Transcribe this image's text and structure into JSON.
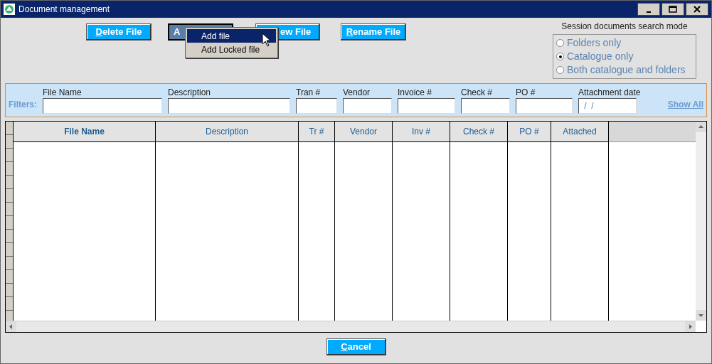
{
  "window": {
    "title": "Document management"
  },
  "toolbar": [
    {
      "kind": "button",
      "label": "Delete File",
      "underlined_first": true
    },
    {
      "kind": "pressed",
      "label": "A",
      "underlined_first": false
    },
    {
      "kind": "button",
      "label": "ew File",
      "underlined_first": false
    },
    {
      "kind": "button",
      "label": "Rename File",
      "underlined_first": true
    }
  ],
  "menu": [
    {
      "label": "Add file",
      "selected": true
    },
    {
      "label": "Add Locked file",
      "selected": false
    }
  ],
  "search_mode": {
    "title": "Session documents search mode",
    "options": [
      {
        "label": "Folders only",
        "selected": false
      },
      {
        "label": "Catalogue only",
        "selected": true
      },
      {
        "label": "Both catalogue and folders",
        "selected": false
      }
    ]
  },
  "filters": {
    "label": "Filters:",
    "fields": [
      {
        "label": "File Name"
      },
      {
        "label": "Description"
      },
      {
        "label": "Tran #"
      },
      {
        "label": "Vendor"
      },
      {
        "label": "Invoice #"
      },
      {
        "label": "Check #"
      },
      {
        "label": "PO #"
      },
      {
        "label": "Attachment date",
        "value": " /  /"
      }
    ],
    "show_all": "Show All"
  },
  "table": {
    "columns": [
      {
        "label": "File Name",
        "bold": true
      },
      {
        "label": "Description",
        "bold": false
      },
      {
        "label": "Tr #",
        "bold": false
      },
      {
        "label": "Vendor",
        "bold": false
      },
      {
        "label": "Inv #",
        "bold": false
      },
      {
        "label": "Check #",
        "bold": false
      },
      {
        "label": "PO #",
        "bold": false
      },
      {
        "label": "Attached",
        "bold": false
      }
    ]
  },
  "footer": {
    "button": "Cancel",
    "underlined_first": true
  }
}
